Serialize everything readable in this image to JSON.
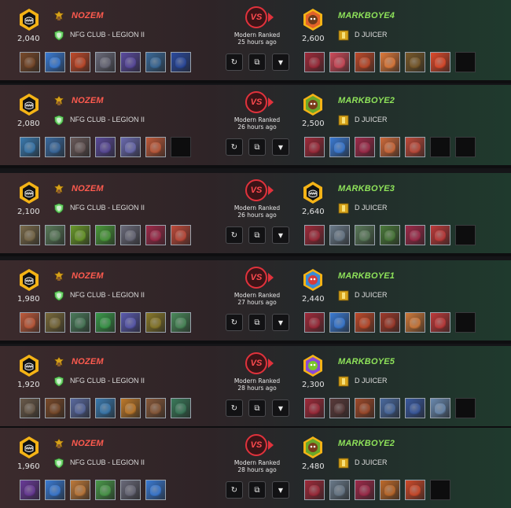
{
  "colors": {
    "left_name": "#ff5b4f",
    "right_name": "#8fe35a",
    "vs_red": "#e0323c",
    "card_border": "#9aa3ad"
  },
  "icons": {
    "replay": "↻",
    "copy": "⧉",
    "dropdown": "▼"
  },
  "vs_label": "VS",
  "battles": [
    {
      "left": {
        "name": "NOZEM",
        "rating": "2,040",
        "guild": "NFG CLUB - LEGION II",
        "avatar": "black-monster-emblem",
        "cards": [
          "#7a4a2a",
          "#3a7bd5",
          "#c24a2a",
          "#6a6a7a",
          "#5a4aa0",
          "#3a6a9a",
          "#2a4aa0"
        ]
      },
      "right": {
        "name": "MARKBOYE4",
        "rating": "2,600",
        "guild": "D JUICER",
        "avatar": "orange-character",
        "cards": [
          "#a02a3a",
          "#d04a5a",
          "#c04a2a",
          "#e07a3a",
          "#7a5a2a",
          "#e04a2a",
          null
        ]
      },
      "mode": "Modern Ranked",
      "time": "25 hours ago"
    },
    {
      "left": {
        "name": "NOZEM",
        "rating": "2,080",
        "guild": "NFG CLUB - LEGION II",
        "avatar": "black-monster-emblem",
        "cards": [
          "#3a7ab0",
          "#3a6aa0",
          "#6a5a5a",
          "#5a4a9a",
          "#6a6ab0",
          "#c05a3a",
          null
        ]
      },
      "right": {
        "name": "MARKBOYE2",
        "rating": "2,500",
        "guild": "D JUICER",
        "avatar": "green-character",
        "cards": [
          "#a02a3a",
          "#3a7bd5",
          "#a02a4a",
          "#d06a3a",
          "#c04a3a",
          null,
          null
        ]
      },
      "mode": "Modern Ranked",
      "time": "26 hours ago"
    },
    {
      "left": {
        "name": "NOZEM",
        "rating": "2,100",
        "guild": "NFG CLUB - LEGION II",
        "avatar": "black-monster-emblem",
        "cards": [
          "#7a6a4a",
          "#5a7a5a",
          "#6a9a2a",
          "#4a9a3a",
          "#6a6a7a",
          "#a02a4a",
          "#c04a3a"
        ]
      },
      "right": {
        "name": "MARKBOYE3",
        "rating": "2,640",
        "guild": "D JUICER",
        "avatar": "black-monster-emblem",
        "cards": [
          "#a02a3a",
          "#6a7a8a",
          "#5a7a5a",
          "#4a7a3a",
          "#a02a4a",
          "#c03a3a",
          null
        ]
      },
      "mode": "Modern Ranked",
      "time": "26 hours ago"
    },
    {
      "left": {
        "name": "NOZEM",
        "rating": "1,980",
        "guild": "NFG CLUB - LEGION II",
        "avatar": "black-monster-emblem",
        "cards": [
          "#c05a3a",
          "#7a6a3a",
          "#4a7a5a",
          "#3a9a4a",
          "#5a5ab0",
          "#8a7a2a",
          "#4a8a5a"
        ]
      },
      "right": {
        "name": "MARKBOYE1",
        "rating": "2,440",
        "guild": "D JUICER",
        "avatar": "blue-fish-character",
        "cards": [
          "#a02a3a",
          "#3a7bd5",
          "#c04a2a",
          "#a03a2a",
          "#d07a3a",
          "#c03a3a",
          null
        ]
      },
      "mode": "Modern Ranked",
      "time": "27 hours ago"
    },
    {
      "left": {
        "name": "NOZEM",
        "rating": "1,920",
        "guild": "NFG CLUB - LEGION II",
        "avatar": "black-monster-emblem",
        "cards": [
          "#6a5a4a",
          "#7a4a2a",
          "#5a6aa0",
          "#3a7ab0",
          "#c07a2a",
          "#8a5a3a",
          "#3a7a5a"
        ]
      },
      "right": {
        "name": "MARKBOYE5",
        "rating": "2,300",
        "guild": "D JUICER",
        "avatar": "purple-green-character",
        "cards": [
          "#a02a3a",
          "#5a3a3a",
          "#a04a2a",
          "#4a6aa0",
          "#3a5aa0",
          "#6a8ab0",
          null
        ]
      },
      "mode": "Modern Ranked",
      "time": "28 hours ago"
    },
    {
      "left": {
        "name": "NOZEM",
        "rating": "1,960",
        "guild": "NFG CLUB - LEGION II",
        "avatar": "black-monster-emblem",
        "cards": [
          "#6a3a9a",
          "#3a7bd5",
          "#c07a3a",
          "#4a9a4a",
          "#6a6a7a",
          "#3a7bd5"
        ]
      },
      "right": {
        "name": "MARKBOYE2",
        "rating": "2,480",
        "guild": "D JUICER",
        "avatar": "green-character",
        "cards": [
          "#a02a3a",
          "#6a7a8a",
          "#a02a4a",
          "#c06a2a",
          "#d04a2a",
          null
        ]
      },
      "mode": "Modern Ranked",
      "time": "28 hours ago"
    }
  ]
}
